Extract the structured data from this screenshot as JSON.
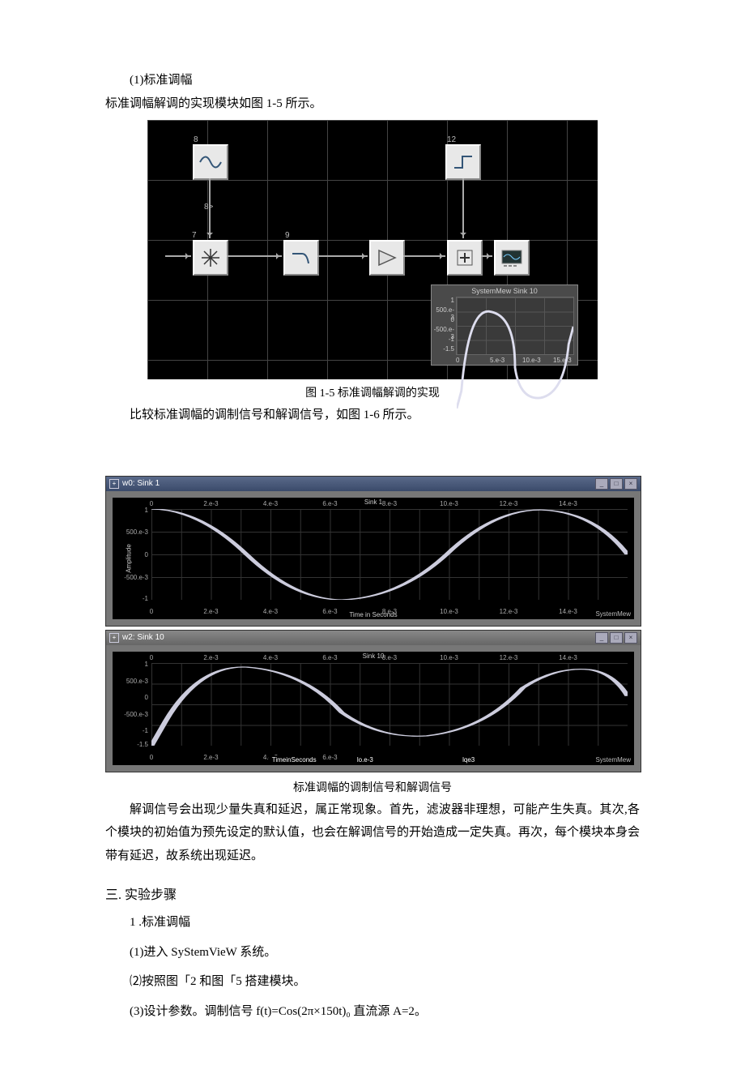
{
  "text": {
    "p1": "(1)标准调幅",
    "p2": "标准调幅解调的实现模块如图 1-5 所示。",
    "fig1_5_cap": "图 1-5 标准调幅解调的实现",
    "p3": "比较标准调幅的调制信号和解调信号，如图 1-6 所示。",
    "fig1_6_cap": "标准调幅的调制信号和解调信号",
    "p4": "解调信号会出现少量失真和延迟，属正常现象。首先，滤波器非理想，可能产生失真。其次,各个模块的初始值为预先设定的默认值，也会在解调信号的开始造成一定失真。再次，每个模块本身会带有延迟，故系统出现延迟。",
    "h_steps": "三. 实验步骤",
    "s1": "1 .标准调幅",
    "s2": "(1)进入 SyStemVieW 系统。",
    "s3": "⑵按照图「2 和图「5 搭建模块。",
    "s4": "(3)设计参数。调制信号 f(t)=Cos(2π×150t)₀ 直流源 A=2。"
  },
  "diagram": {
    "block_ids": {
      "sine": "8",
      "mult": "7",
      "lpf": "9",
      "rect": "12"
    },
    "arrow_label": "8>",
    "mini_plot": {
      "title": "SystemMew Sink 10",
      "yticks": [
        "1",
        "500.e-3",
        "0",
        "-500.e-3",
        "-1",
        "-1.5"
      ],
      "xticks": [
        "0",
        "5.e-3",
        "10.e-3",
        "15.e-3"
      ]
    }
  },
  "sink1": {
    "title": "w0: Sink 1",
    "plot_title": "Sink 1",
    "xaxis_title": "Time in Seconds",
    "yaxis_title": "Amplitude",
    "brand": "SystemMew",
    "xticks": [
      "0",
      "2.e-3",
      "4.e-3",
      "6.e-3",
      "8.e-3",
      "10.e-3",
      "12.e-3",
      "14.e-3"
    ],
    "yticks": [
      "1",
      "500.e-3",
      "0",
      "-500.e-3",
      "-1"
    ]
  },
  "sink10": {
    "title": "w2: Sink 10",
    "plot_title": "Sink 10",
    "xaxis_title": "TimeinSeconds",
    "brand": "SystemMew",
    "xticks": [
      "0",
      "2.e-3",
      "4.e-3",
      "6.e-3",
      "8.e-3",
      "10.e-3",
      "12.e-3",
      "14.e-3"
    ],
    "extra1": "lo.e-3",
    "extra2": "lqe3",
    "yticks": [
      "1",
      "500.e-3",
      "0",
      "-500.e-3",
      "-1",
      "-1.5"
    ]
  },
  "chart_data": [
    {
      "type": "diagram",
      "description": "Block diagram: source(8) → multiplier(7) → LPF(9) → gain → adder(+) with DC block(12) input → scope",
      "inset_plot": {
        "type": "line",
        "xlim": [
          0,
          0.015
        ],
        "ylim": [
          -1.5,
          1
        ],
        "title": "SystemMew Sink 10"
      }
    },
    {
      "type": "line",
      "title": "Sink 1",
      "xlabel": "Time in Seconds",
      "ylabel": "Amplitude",
      "xlim": [
        0,
        0.016
      ],
      "ylim": [
        -1,
        1
      ],
      "series": [
        {
          "name": "w0",
          "note": "cosine ≈150 Hz, amplitude ≈1"
        }
      ]
    },
    {
      "type": "line",
      "title": "Sink 10",
      "xlabel": "Time in Seconds",
      "xlim": [
        0,
        0.016
      ],
      "ylim": [
        -1.5,
        1
      ],
      "series": [
        {
          "name": "w2",
          "note": "demodulated cosine, amplitude ≈1 with initial transient dip near -1.5 and slight delay"
        }
      ]
    }
  ]
}
